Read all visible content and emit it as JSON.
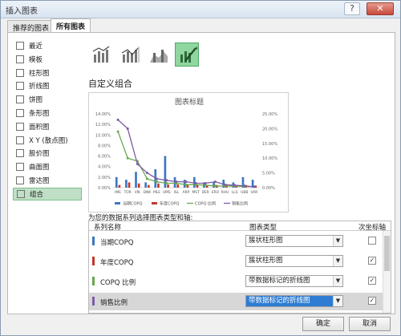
{
  "window": {
    "title": "插入图表",
    "help": "?",
    "close": "✕"
  },
  "tabs": [
    "推荐的图表",
    "所有图表"
  ],
  "sidebar": {
    "items": [
      {
        "label": "最近",
        "icon": "recent-icon"
      },
      {
        "label": "模板",
        "icon": "template-icon"
      },
      {
        "label": "柱形图",
        "icon": "column-chart-icon"
      },
      {
        "label": "折线图",
        "icon": "line-chart-icon"
      },
      {
        "label": "饼图",
        "icon": "pie-chart-icon"
      },
      {
        "label": "条形图",
        "icon": "bar-chart-icon"
      },
      {
        "label": "面积图",
        "icon": "area-chart-icon"
      },
      {
        "label": "X Y (散点图)",
        "icon": "scatter-chart-icon"
      },
      {
        "label": "股价图",
        "icon": "stock-chart-icon"
      },
      {
        "label": "曲面图",
        "icon": "surface-chart-icon"
      },
      {
        "label": "雷达图",
        "icon": "radar-chart-icon"
      },
      {
        "label": "组合",
        "icon": "combo-chart-icon"
      }
    ],
    "selected": 11
  },
  "combo_heading": "自定义组合",
  "preview": {
    "title": "图表标题",
    "left_ticks": [
      "14.00%",
      "12.00%",
      "10.00%",
      "8.00%",
      "6.00%",
      "4.00%",
      "2.00%",
      "0.00%"
    ],
    "right_ticks": [
      "25.00%",
      "20.00%",
      "15.00%",
      "10.00%",
      "5.00%",
      "0.00%"
    ],
    "categories": [
      "IME",
      "TOR",
      "VIK",
      "DNK",
      "MLE",
      "UMS",
      "ISL",
      "ARP",
      "MST",
      "DER",
      "ERO",
      "RHU",
      "LLS",
      "UBB",
      "VAR"
    ],
    "legend": [
      "当期COPQ",
      "年度COPQ",
      "COPQ 比例",
      "销售比例"
    ]
  },
  "chart_data": {
    "type": "combo",
    "title": "图表标题",
    "categories": [
      "IME",
      "TOR",
      "VIK",
      "DNK",
      "MLE",
      "UMS",
      "ISL",
      "ARP",
      "MST",
      "DER",
      "ERO",
      "RHU",
      "LLS",
      "UBB",
      "VAR"
    ],
    "series": [
      {
        "name": "当期COPQ",
        "type": "bar",
        "axis": "left",
        "values": [
          2.0,
          1.5,
          3.0,
          1.0,
          3.5,
          6.0,
          2.0,
          1.5,
          2.0,
          1.0,
          1.0,
          1.5,
          1.0,
          2.0,
          1.5
        ]
      },
      {
        "name": "年度COPQ",
        "type": "bar",
        "axis": "left",
        "values": [
          0.5,
          1.0,
          0.8,
          0.5,
          0.8,
          0.6,
          0.6,
          0.5,
          0.6,
          0.4,
          0.5,
          0.5,
          0.4,
          0.5,
          0.4
        ]
      },
      {
        "name": "COPQ 比例",
        "type": "line",
        "axis": "right",
        "values": [
          19.0,
          10.0,
          9.0,
          3.0,
          2.0,
          1.5,
          1.5,
          1.0,
          1.0,
          0.8,
          0.6,
          0.5,
          0.5,
          0.4,
          0.3
        ]
      },
      {
        "name": "销售比例",
        "type": "line",
        "axis": "right",
        "values": [
          23.0,
          20.0,
          8.0,
          5.0,
          3.0,
          2.5,
          2.0,
          2.0,
          1.5,
          1.5,
          2.0,
          1.0,
          0.8,
          0.6,
          0.3
        ]
      }
    ],
    "ylim_left": [
      0,
      14
    ],
    "ylim_right": [
      0,
      25
    ],
    "legend_position": "bottom"
  },
  "instruction": "为您的数据系列选择图表类型和轴:",
  "table": {
    "headers": [
      "系列名称",
      "图表类型",
      "次坐标轴"
    ],
    "rows": [
      {
        "name": "当期COPQ",
        "color": "#3c78c3",
        "type": "簇状柱形图",
        "secondary": false
      },
      {
        "name": "年度COPQ",
        "color": "#c0392b",
        "type": "簇状柱形图",
        "secondary": true
      },
      {
        "name": "COPQ 比例",
        "color": "#6aa84f",
        "type": "带数据标记的折线图",
        "secondary": true
      },
      {
        "name": "销售比例",
        "color": "#7d5ca6",
        "type": "带数据标记的折线图",
        "secondary": true
      }
    ]
  },
  "buttons": {
    "ok": "确定",
    "cancel": "取消"
  }
}
